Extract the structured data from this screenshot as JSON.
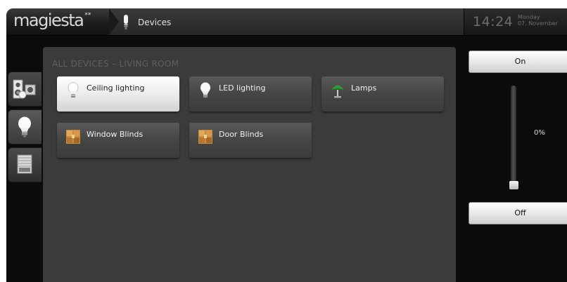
{
  "header": {
    "logo_text": "magiesta",
    "logo_mark": "**",
    "breadcrumb_label": "Devices",
    "breadcrumb_icon": "light-bulb-icon",
    "time": "14:24",
    "day": "Monday",
    "date": "07. November"
  },
  "side_tabs": [
    {
      "name": "speakers-icon",
      "active": false
    },
    {
      "name": "light-bulb-icon",
      "active": true
    },
    {
      "name": "blinds-icon",
      "active": false
    }
  ],
  "main": {
    "title": "ALL DEVICES – LIVING ROOM",
    "devices": [
      {
        "label": "Ceiling lighting",
        "icon": "light-bulb-icon",
        "active": true
      },
      {
        "label": "LED lighting",
        "icon": "light-bulb-icon",
        "active": false
      },
      {
        "label": "Lamps",
        "icon": "lamp-icon",
        "active": false
      },
      {
        "label": "Window Blinds",
        "icon": "blinds-box-icon",
        "active": false
      },
      {
        "label": "Door Blinds",
        "icon": "blinds-box-icon",
        "active": false
      }
    ]
  },
  "control": {
    "on_label": "On",
    "off_label": "Off",
    "level_text": "0%",
    "level": 0
  },
  "colors": {
    "background": "#0b0b0b",
    "panel": "#3a3b3b",
    "active_tile": "#ffffff",
    "tile": "#4c4c4c",
    "lamp_green": "#2f9a3a",
    "blinds_orange": "#c88a3c"
  }
}
